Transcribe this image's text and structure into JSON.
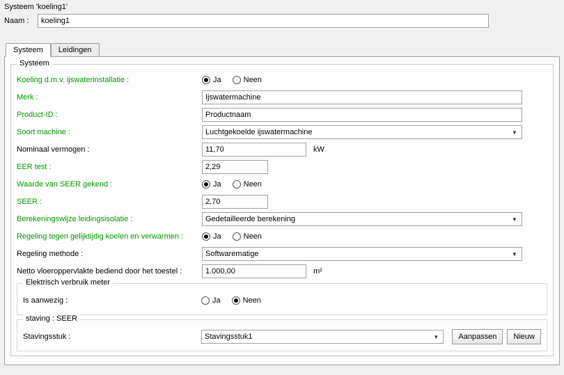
{
  "window_title": "Systeem 'koeling1'",
  "name_label": "Naam :",
  "name_value": "koeling1",
  "tabs": {
    "systeem": "Systeem",
    "leidingen": "Leidingen"
  },
  "group_systeem": "Systeem",
  "labels": {
    "koeling_ijswater": "Koeling d.m.v. ijswaterinstallatie :",
    "merk": "Merk :",
    "product_id": "Product-ID :",
    "soort_machine": "Soort machine :",
    "nominaal_vermogen": "Nominaal vermogen :",
    "eer_test": "EER test :",
    "seer_gekend": "Waarde van SEER gekend :",
    "seer": "SEER :",
    "berekeningswijze": "Berekeningswijze leidingsisolatie :",
    "regeling_koelen": "Regeling tegen gelijktijdig koelen en verwarmen :",
    "regeling_methode": "Regeling methode :",
    "netto_vloer": "Netto vloeroppervlakte bediend door het toestel :",
    "elektrisch_verbruik": "Elektrisch verbruik meter",
    "is_aanwezig": "Is aanwezig :",
    "staving_group": "staving : SEER",
    "stavingsstuk": "Stavingsstuk :"
  },
  "values": {
    "merk": "Ijswatermachine",
    "product_id": "Productnaam",
    "soort_machine": "Luchtgekoelde ijswatermachine",
    "nominaal_vermogen": "11,70",
    "nominaal_unit": "kW",
    "eer_test": "2,29",
    "seer": "2,70",
    "berekeningswijze": "Gedetailleerde berekening",
    "regeling_methode": "Softwarematige",
    "netto_vloer": "1.000,00",
    "netto_unit": "m²",
    "stavingsstuk": "Stavingsstuk1"
  },
  "radio": {
    "ja": "Ja",
    "neen": "Neen"
  },
  "buttons": {
    "aanpassen": "Aanpassen",
    "nieuw": "Nieuw"
  }
}
